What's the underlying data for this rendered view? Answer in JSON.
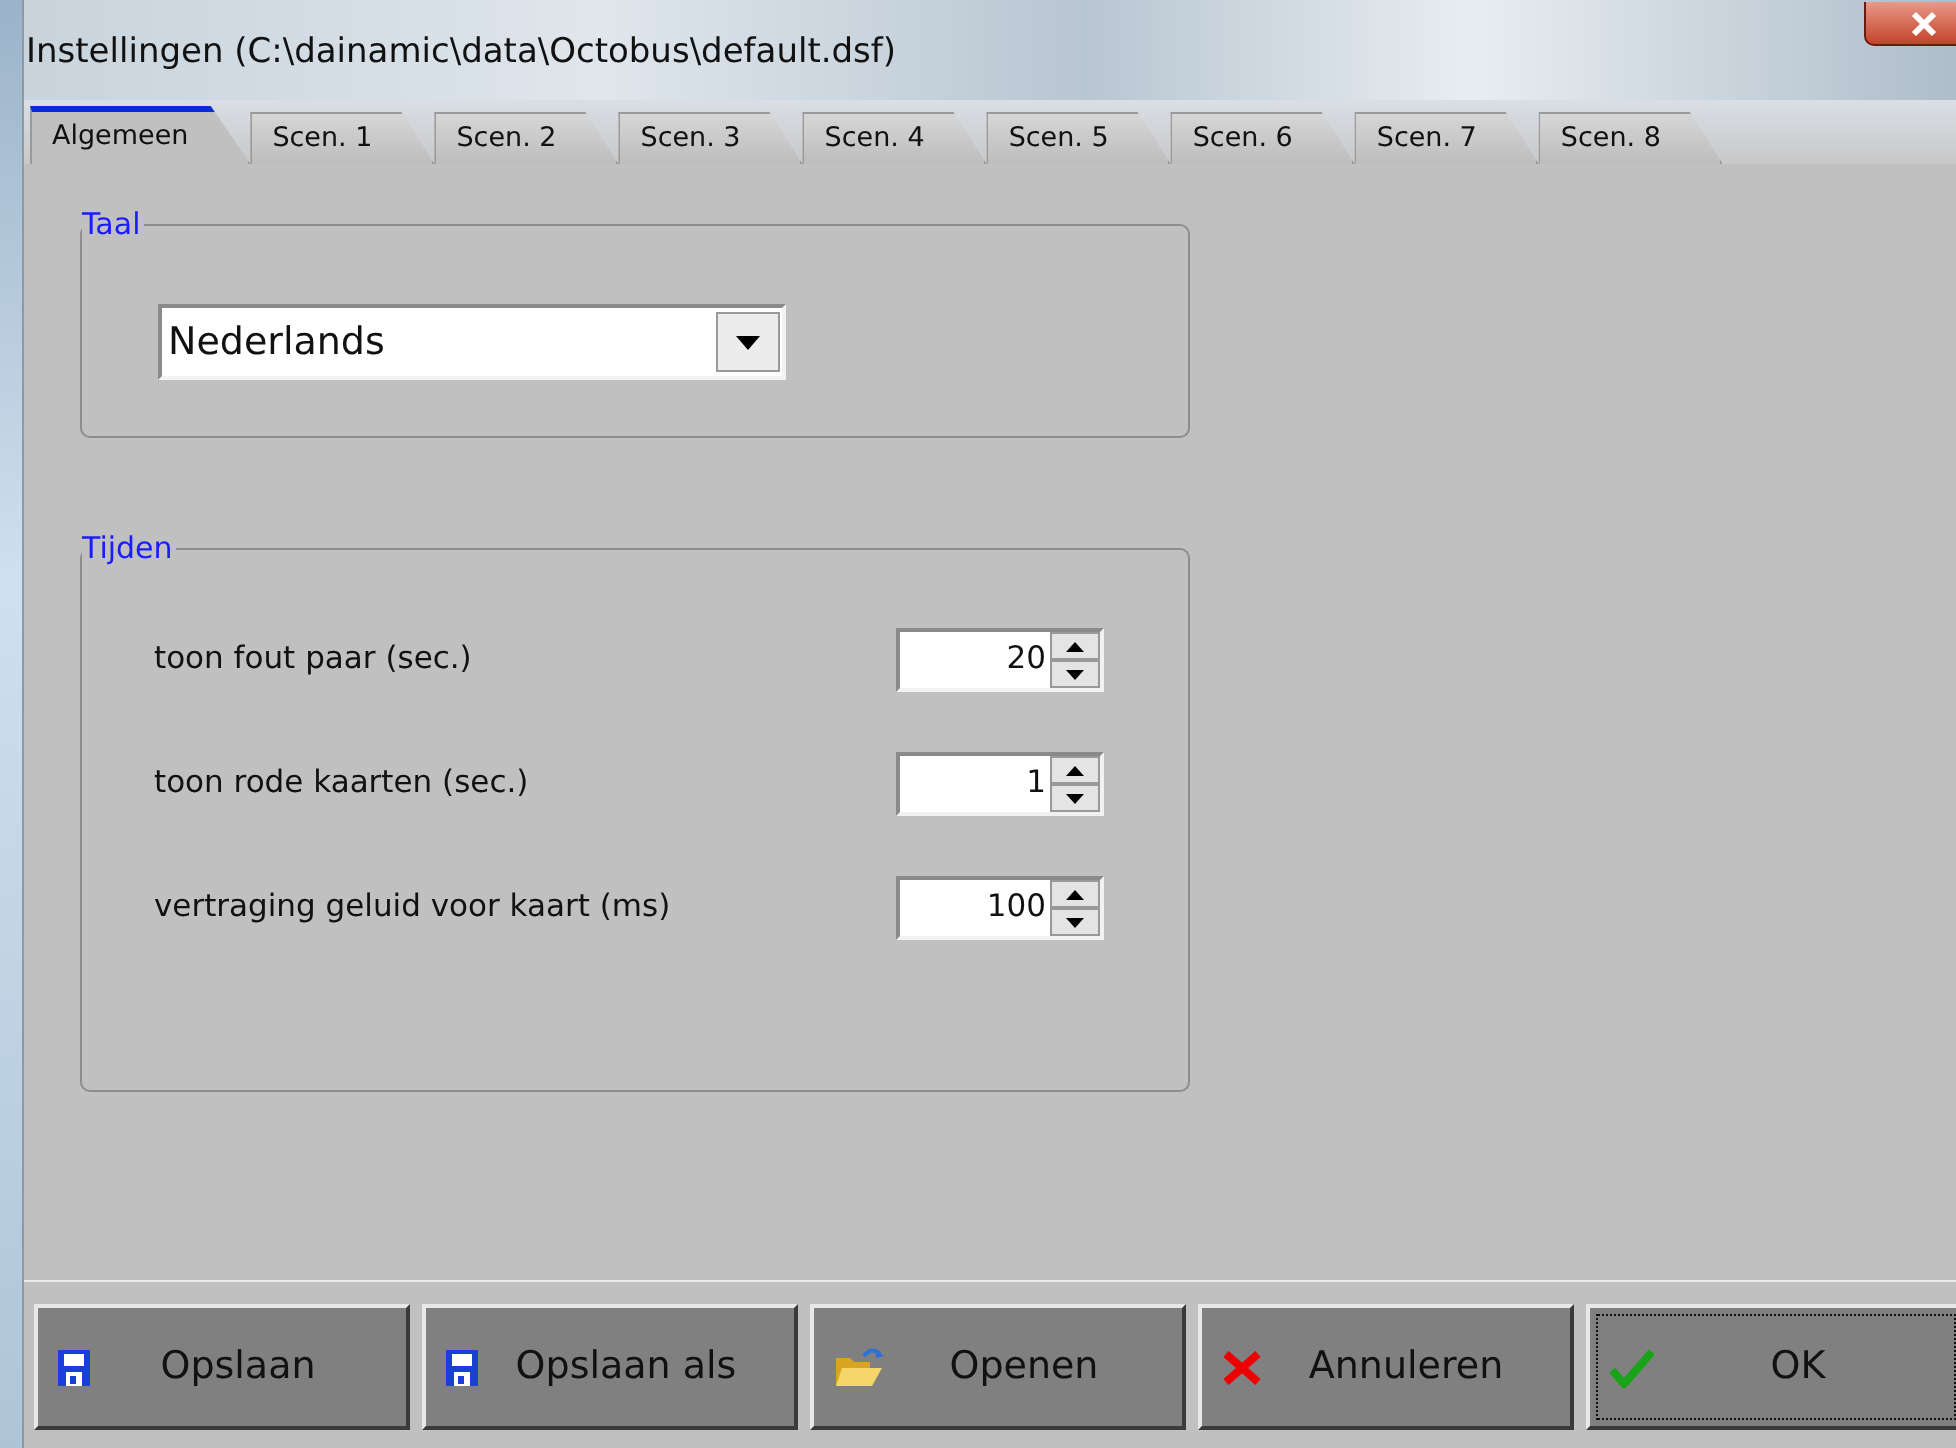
{
  "window": {
    "title": "Instellingen (C:\\dainamic\\data\\Octobus\\default.dsf)"
  },
  "tabs": [
    {
      "label": "Algemeen",
      "selected": true
    },
    {
      "label": "Scen. 1",
      "selected": false
    },
    {
      "label": "Scen. 2",
      "selected": false
    },
    {
      "label": "Scen. 3",
      "selected": false
    },
    {
      "label": "Scen. 4",
      "selected": false
    },
    {
      "label": "Scen. 5",
      "selected": false
    },
    {
      "label": "Scen. 6",
      "selected": false
    },
    {
      "label": "Scen. 7",
      "selected": false
    },
    {
      "label": "Scen. 8",
      "selected": false
    }
  ],
  "language_group": {
    "title": "Taal",
    "dropdown": {
      "value": "Nederlands"
    }
  },
  "times_group": {
    "title": "Tijden",
    "fields": [
      {
        "label": "toon fout paar (sec.)",
        "value": "20"
      },
      {
        "label": "toon rode kaarten (sec.)",
        "value": "1"
      },
      {
        "label": "vertraging geluid voor kaart (ms)",
        "value": "100"
      }
    ]
  },
  "buttons": [
    {
      "label": "Opslaan",
      "kind": "save",
      "focused": false
    },
    {
      "label": "Opslaan als",
      "kind": "save",
      "focused": false
    },
    {
      "label": "Openen",
      "kind": "open",
      "focused": false
    },
    {
      "label": "Annuleren",
      "kind": "cancel",
      "focused": false
    },
    {
      "label": "OK",
      "kind": "ok",
      "focused": true
    }
  ]
}
